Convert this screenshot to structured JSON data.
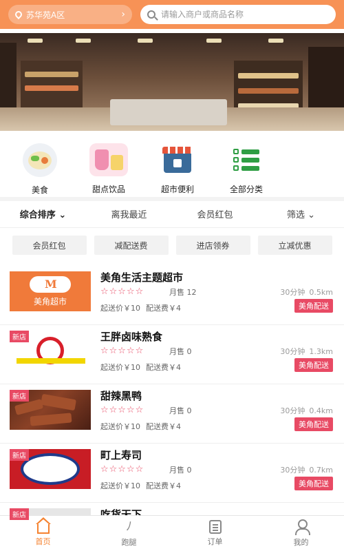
{
  "header": {
    "location": "苏华苑A区",
    "search_placeholder": "请输入商户或商品名称"
  },
  "categories": [
    {
      "label": "美食",
      "icon": "food-plate-icon"
    },
    {
      "label": "甜点饮品",
      "icon": "dessert-drink-icon"
    },
    {
      "label": "超市便利",
      "icon": "supermarket-icon"
    },
    {
      "label": "全部分类",
      "icon": "list-icon"
    }
  ],
  "sort": {
    "items": [
      "综合排序",
      "离我最近",
      "会员红包",
      "筛选"
    ]
  },
  "promos": [
    "会员红包",
    "减配送费",
    "进店领券",
    "立减优惠"
  ],
  "shops": [
    {
      "name": "美角生活主题超市",
      "is_new": false,
      "new_label": "",
      "rating_stars": "☆☆☆☆☆",
      "sales": "月售 12",
      "min_order": "起送价￥10",
      "delivery_fee": "配送费￥4",
      "time": "30分钟",
      "distance": "0.5km",
      "badge": "美角配送",
      "thumb_text": "美角超市"
    },
    {
      "name": "王胖卤味熟食",
      "is_new": true,
      "new_label": "新店",
      "rating_stars": "☆☆☆☆☆",
      "sales": "月售 0",
      "min_order": "起送价￥10",
      "delivery_fee": "配送费￥4",
      "time": "30分钟",
      "distance": "1.3km",
      "badge": "美角配送"
    },
    {
      "name": "甜辣黑鸭",
      "is_new": true,
      "new_label": "新店",
      "rating_stars": "☆☆☆☆☆",
      "sales": "月售 0",
      "min_order": "起送价￥10",
      "delivery_fee": "配送费￥4",
      "time": "30分钟",
      "distance": "0.4km",
      "badge": "美角配送"
    },
    {
      "name": "町上寿司",
      "is_new": true,
      "new_label": "新店",
      "rating_stars": "☆☆☆☆☆",
      "sales": "月售 0",
      "min_order": "起送价￥10",
      "delivery_fee": "配送费￥4",
      "time": "30分钟",
      "distance": "0.7km",
      "badge": "美角配送"
    },
    {
      "name": "吃货天下",
      "is_new": true,
      "new_label": "新店"
    }
  ],
  "nav": [
    {
      "label": "首页",
      "icon": "home-icon",
      "active": true
    },
    {
      "label": "跑腿",
      "icon": "errand-runner-icon",
      "active": false
    },
    {
      "label": "订单",
      "icon": "order-icon",
      "active": false
    },
    {
      "label": "我的",
      "icon": "profile-icon",
      "active": false
    }
  ],
  "colors": {
    "header_orange": "#f79256",
    "accent_pink": "#e84a64",
    "nav_active": "#f5822f"
  }
}
